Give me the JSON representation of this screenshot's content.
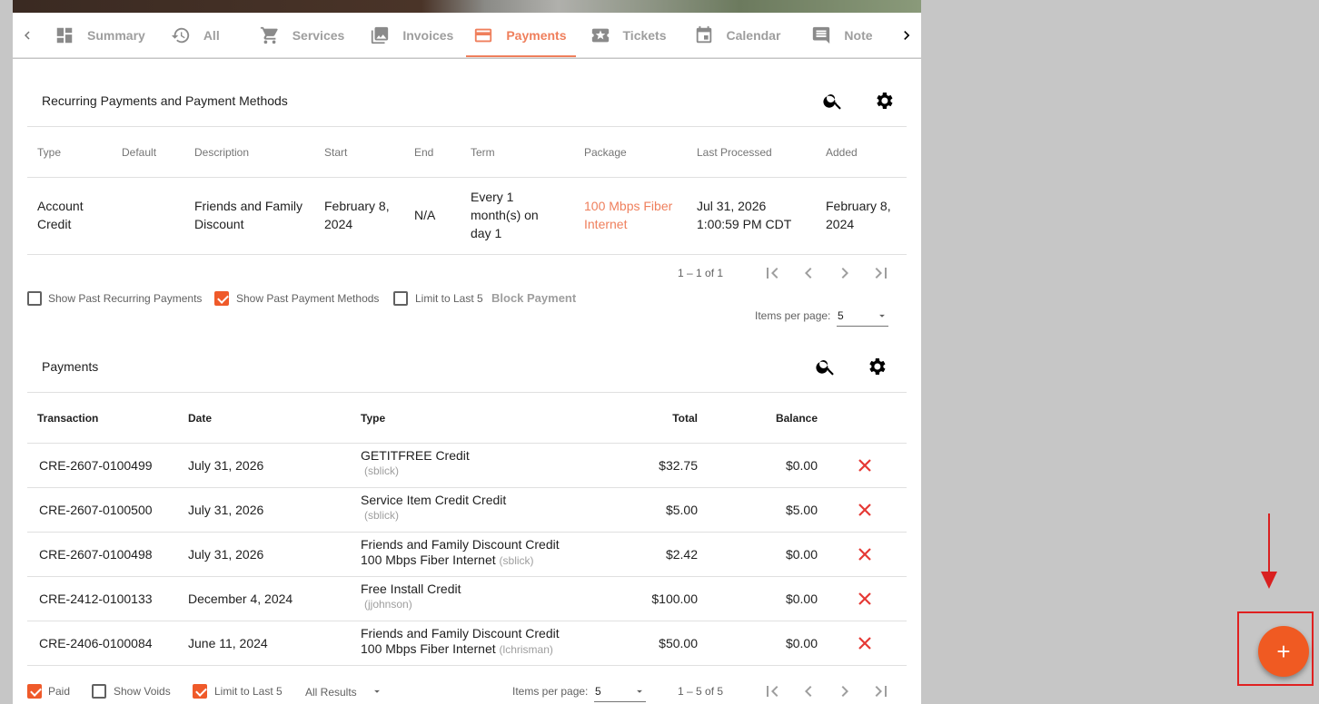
{
  "tabs": [
    {
      "label": "Summary",
      "icon": "dashboard-icon"
    },
    {
      "label": "All",
      "icon": "history-icon"
    },
    {
      "label": "Services",
      "icon": "cart-icon"
    },
    {
      "label": "Invoices",
      "icon": "image-icon"
    },
    {
      "label": "Payments",
      "icon": "credit-card-icon",
      "active": true
    },
    {
      "label": "Tickets",
      "icon": "ticket-icon"
    },
    {
      "label": "Calendar",
      "icon": "calendar-icon"
    },
    {
      "label": "Note",
      "icon": "comment-icon"
    }
  ],
  "recurring": {
    "title": "Recurring Payments and Payment Methods",
    "columns": [
      "Type",
      "Default",
      "Description",
      "Start",
      "End",
      "Term",
      "Package",
      "Last Processed",
      "Added"
    ],
    "rows": [
      {
        "type_line1": "Account",
        "type_line2": "Credit",
        "default": "",
        "desc_line1": "Friends and Family",
        "desc_line2": "Discount",
        "start_line1": "February 8,",
        "start_line2": "2024",
        "end": "N/A",
        "term_line1": "Every 1",
        "term_line2": "month(s) on",
        "term_line3": "day 1",
        "package_line1": "100 Mbps Fiber",
        "package_line2": "Internet",
        "last_line1": "Jul 31, 2026",
        "last_line2": "1:00:59 PM CDT",
        "added_line1": "February 8,",
        "added_line2": "2024"
      }
    ],
    "range": "1 – 1 of 1",
    "show_past_recurring": "Show Past Recurring Payments",
    "show_past_methods": "Show Past Payment Methods",
    "limit_last5": "Limit to Last 5",
    "block_payment": "Block Payment",
    "items_per_page_label": "Items per page:",
    "items_per_page": "5"
  },
  "payments": {
    "title": "Payments",
    "columns": [
      "Transaction",
      "Date",
      "Type",
      "Total",
      "Balance"
    ],
    "rows": [
      {
        "transaction": "CRE-2607-0100499",
        "date": "July 31, 2026",
        "type_main": "GETITFREE Credit",
        "type_line2": "",
        "user": "(sblick)",
        "total": "$32.75",
        "balance": "$0.00"
      },
      {
        "transaction": "CRE-2607-0100500",
        "date": "July 31, 2026",
        "type_main": "Service Item Credit Credit",
        "type_line2": "",
        "user": "(sblick)",
        "total": "$5.00",
        "balance": "$5.00"
      },
      {
        "transaction": "CRE-2607-0100498",
        "date": "July 31, 2026",
        "type_main": "Friends and Family Discount Credit",
        "type_line2": "100 Mbps Fiber Internet",
        "user": "(sblick)",
        "total": "$2.42",
        "balance": "$0.00"
      },
      {
        "transaction": "CRE-2412-0100133",
        "date": "December 4, 2024",
        "type_main": "Free Install Credit",
        "type_line2": "",
        "user": "(jjohnson)",
        "total": "$100.00",
        "balance": "$0.00"
      },
      {
        "transaction": "CRE-2406-0100084",
        "date": "June 11, 2024",
        "type_main": "Friends and Family Discount Credit",
        "type_line2": "100 Mbps Fiber Internet",
        "user": "(lchrisman)",
        "total": "$50.00",
        "balance": "$0.00"
      }
    ],
    "paid_label": "Paid",
    "show_voids_label": "Show Voids",
    "limit_last5": "Limit to Last 5",
    "filter_value": "All Results",
    "items_per_page_label": "Items per page:",
    "items_per_page": "5",
    "range": "1 – 5 of 5"
  },
  "fab": {
    "label": "+"
  },
  "colors": {
    "accent": "#ef7f5c",
    "fab": "#f05a22",
    "delete": "#e53935"
  }
}
